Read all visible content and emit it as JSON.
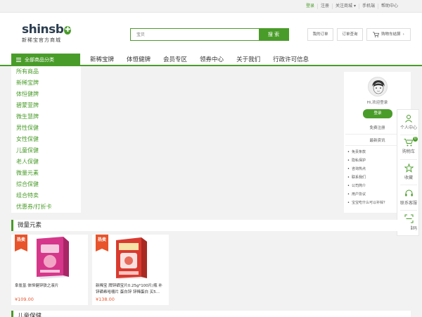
{
  "topbar": {
    "links": [
      "登录",
      "注册",
      "关注商城 ▾",
      "手机端",
      "帮助中心"
    ]
  },
  "header": {
    "logo_main": "shinsb",
    "logo_sub": "新稀宝官方商城",
    "search_placeholder": "宝贝",
    "search_button": "搜 索",
    "my_orders": "我的订单",
    "order_query": "订单查询",
    "cart_checkout": "购物车结算",
    "cart_arrow": "›"
  },
  "nav": {
    "category_label": "全部商品分类",
    "items": [
      "新稀宝牌",
      "体恒健牌",
      "会员专区",
      "领券中心",
      "关于我们",
      "行政许可信息"
    ]
  },
  "categories": [
    "所有商品",
    "新稀宝牌",
    "体恒健牌",
    "碧蒙萱牌",
    "微生慧牌",
    "男性保健",
    "女性保健",
    "儿童保健",
    "老人保健",
    "微量元素",
    "综合保健",
    "组合特卖",
    "优惠券/打折卡"
  ],
  "user_panel": {
    "greeting": "Hi,欢迎登录",
    "login": "登录",
    "register": "免费注册",
    "news_title": "最新资讯",
    "news": [
      "免责条款",
      "隐私保护",
      "咨询热点",
      "联系我们",
      "公司简介",
      "用户协议",
      "宝宝吃什么可以补锌？"
    ]
  },
  "sidebar": {
    "personal": "个人中心",
    "cart": "购物车",
    "cart_count": "0",
    "favorite": "收藏",
    "service": "联系客服",
    "qrcode": "扫二维码"
  },
  "sections": [
    {
      "title": "微量元素",
      "products": [
        {
          "badge": "热卖",
          "name": "阜氪氢 体恒健锌铁之液片",
          "price": "¥109.00"
        },
        {
          "badge": "热卖",
          "name": "新稀宝 牌锌硒宝片0.25g*100片/瓶 补锌硒希哈嚼片 蛋白锌 锌稀蛋白 买5...",
          "price": "¥138.00"
        }
      ]
    },
    {
      "title": "儿童保健"
    }
  ],
  "colors": {
    "accent": "#4a9c2a",
    "hot": "#e8542b"
  }
}
